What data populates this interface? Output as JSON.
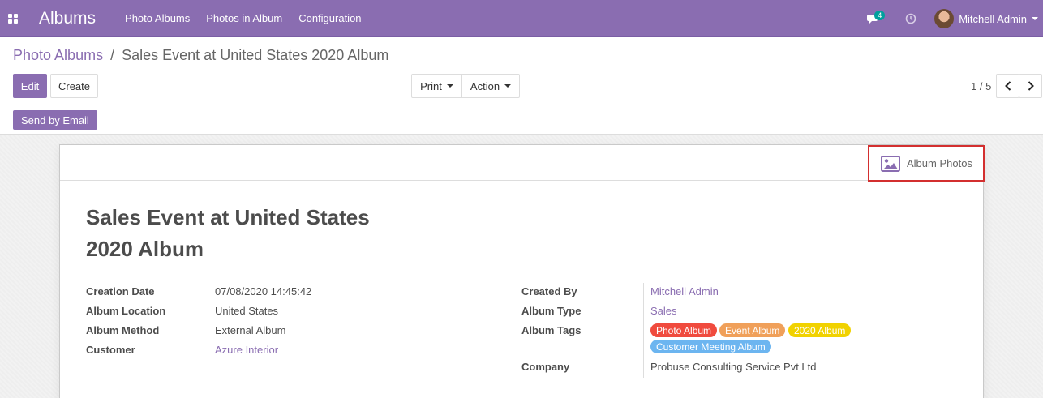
{
  "navbar": {
    "app_title": "Albums",
    "menu": [
      "Photo Albums",
      "Photos in Album",
      "Configuration"
    ],
    "chat_count": "4",
    "user_name": "Mitchell Admin"
  },
  "breadcrumb": {
    "parent": "Photo Albums",
    "separator": "/",
    "current": "Sales Event at United States 2020 Album"
  },
  "toolbar": {
    "edit_label": "Edit",
    "create_label": "Create",
    "print_label": "Print",
    "action_label": "Action",
    "pager": "1 / 5",
    "send_by_email_label": "Send by Email"
  },
  "sheet": {
    "smart_button_label": "Album Photos",
    "title_line1": "Sales Event at United States",
    "title_line2": "2020 Album",
    "left_fields": [
      {
        "label": "Creation Date",
        "value": "07/08/2020 14:45:42"
      },
      {
        "label": "Album Location",
        "value": "United States"
      },
      {
        "label": "Album Method",
        "value": "External Album"
      },
      {
        "label": "Customer",
        "value": "Azure Interior"
      }
    ],
    "right_fields": [
      {
        "label": "Created By",
        "value": "Mitchell Admin"
      },
      {
        "label": "Album Type",
        "value": "Sales"
      },
      {
        "label": "Album Tags",
        "value": ""
      },
      {
        "label": "Company",
        "value": "Probuse Consulting Service Pvt Ltd"
      }
    ],
    "tags": [
      {
        "label": "Photo Album",
        "color": "#f04b3e"
      },
      {
        "label": "Event Album",
        "color": "#f0a05a"
      },
      {
        "label": "2020 Album",
        "color": "#f1d200"
      },
      {
        "label": "Customer Meeting Album",
        "color": "#6cb5f0"
      }
    ]
  },
  "colors": {
    "brand": "#8a6db1",
    "highlight_border": "#d32f2f"
  }
}
